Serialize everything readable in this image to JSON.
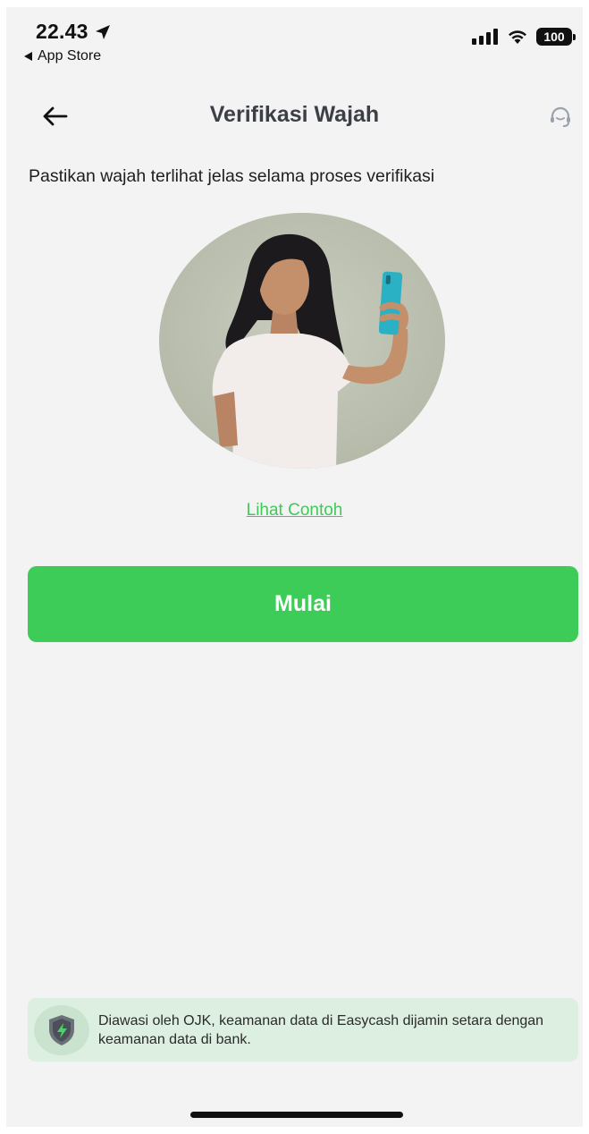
{
  "status_bar": {
    "time": "22.43",
    "back_app_label": "App Store",
    "battery": "100"
  },
  "header": {
    "title": "Verifikasi Wajah"
  },
  "content": {
    "instruction": "Pastikan wajah terlihat jelas selama proses verifikasi",
    "example_link": "Lihat Contoh",
    "start_button": "Mulai"
  },
  "trust_banner": {
    "text": "Diawasi oleh OJK, keamanan data di Easycash dijamin setara dengan keamanan data di bank."
  },
  "colors": {
    "accent": "#3ecc59",
    "link": "#43c75c",
    "background": "#f3f3f3",
    "banner_background": "#dcefe0",
    "title": "#3c3f48"
  }
}
